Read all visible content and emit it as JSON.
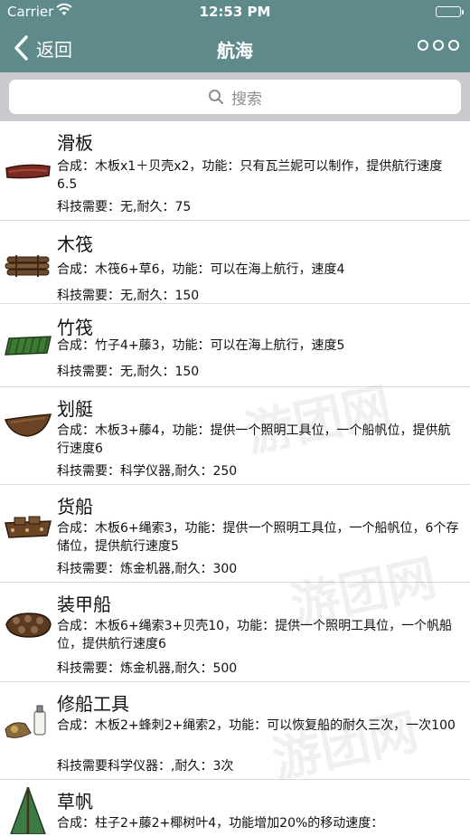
{
  "status": {
    "carrier": "Carrier",
    "time": "12:53 PM",
    "battery_level": 1.0
  },
  "nav": {
    "back_label": "返回",
    "title": "航海"
  },
  "search": {
    "placeholder": "搜索"
  },
  "items": [
    {
      "name": "滑板",
      "desc": "合成：木板x1＋贝壳x2，功能：只有瓦兰妮可以制作，提供航行速度6.5",
      "tech": "科技需要：无,耐久：75",
      "icon": "raft-board-icon"
    },
    {
      "name": "木筏",
      "desc": "合成：木筏6+草6，功能：可以在海上航行，速度4",
      "tech": "科技需要：无,耐久：150",
      "icon": "log-raft-icon"
    },
    {
      "name": "竹筏",
      "desc": "合成：竹子4+藤3，功能：可以在海上航行，速度5",
      "tech": "科技需要：无,耐久：150",
      "icon": "bamboo-raft-icon"
    },
    {
      "name": "划艇",
      "desc": "合成：木板3+藤4，功能：提供一个照明工具位，一个船帆位，提供航行速度6",
      "tech": "科技需要：科学仪器,耐久：250",
      "icon": "rowboat-icon"
    },
    {
      "name": "货船",
      "desc": "合成：木板6+绳索3，功能：提供一个照明工具位，一个船帆位，6个存储位，提供航行速度5",
      "tech": "科技需要：炼金机器,耐久：300",
      "icon": "cargo-boat-icon"
    },
    {
      "name": "装甲船",
      "desc": "合成：木板6+绳索3+贝壳10，功能：提供一个照明工具位，一个帆船位，提供航行速度6",
      "tech": "科技需要：炼金机器,耐久：500",
      "icon": "armored-boat-icon"
    },
    {
      "name": "修船工具",
      "desc": "合成：木板2+蜂刺2+绳索2，功能：可以恢复船的耐久三次，一次100",
      "tech": "科技需要科学仪器：,耐久：3次",
      "icon": "repair-kit-icon"
    },
    {
      "name": "草帆",
      "desc": "合成：柱子2+藤2+椰树叶4，功能增加20%的移动速度：",
      "tech": "",
      "icon": "thatch-sail-icon"
    }
  ],
  "watermark": "游团网",
  "colors": {
    "nav_bg": "#5f8a8b",
    "search_bg": "#c9c9ce",
    "divider": "#dcdcdc"
  }
}
